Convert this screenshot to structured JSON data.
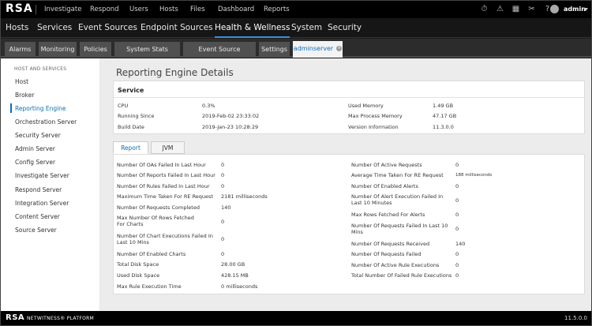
{
  "topbar": {
    "logo": "RSA",
    "nav": [
      "Investigate",
      "Respond",
      "Users",
      "Hosts",
      "Files",
      "Dashboard",
      "Reports"
    ],
    "user": "admin"
  },
  "secnav": {
    "items": [
      "Hosts",
      "Services",
      "Event Sources",
      "Endpoint Sources",
      "Health & Wellness",
      "System",
      "Security"
    ],
    "active": "Health & Wellness"
  },
  "subtabs": {
    "items": [
      "Alarms",
      "Monitoring",
      "Policies",
      "System Stats Browser",
      "Event Source Monitoring",
      "Settings",
      "adminserver"
    ],
    "active": "adminserver"
  },
  "sidebar": {
    "header": "HOST AND SERVICES",
    "items": [
      "Host",
      "Broker",
      "Reporting Engine",
      "Orchestration Server",
      "Security Server",
      "Admin Server",
      "Config Server",
      "Investigate Server",
      "Respond Server",
      "Integration Server",
      "Content Server",
      "Source Server"
    ],
    "active": "Reporting Engine"
  },
  "main": {
    "title": "Reporting Engine Details",
    "service": {
      "title": "Service",
      "left": [
        {
          "label": "CPU",
          "value": "0.3%"
        },
        {
          "label": "Running Since",
          "value": "2019-Feb-02 23:33:02"
        },
        {
          "label": "Build Date",
          "value": "2019-Jan-23 10:28:29"
        }
      ],
      "right": [
        {
          "label": "Used Memory",
          "value": "1.49 GB"
        },
        {
          "label": "Max Process Memory",
          "value": "47.17 GB"
        },
        {
          "label": "Version Information",
          "value": "11.3.0.0"
        }
      ]
    },
    "tabs": [
      "Report",
      "JVM"
    ],
    "active_tab": "Report",
    "report_left": [
      {
        "label": "Number Of OAs Failed In Last Hour",
        "value": "0"
      },
      {
        "label": "Number Of Reports Failed In Last Hour",
        "value": "0"
      },
      {
        "label": "Number Of Rules Failed In Last Hour",
        "value": "0"
      },
      {
        "label": "Maximum Time Taken For RE Request",
        "value": "2181 milliseconds"
      },
      {
        "label": "Number Of Requests Completed",
        "value": "140"
      },
      {
        "label": "Max Number Of Rows Fetched For Charts",
        "value": "0"
      },
      {
        "label": "Number Of Chart Executions Failed In Last 10 Mins",
        "value": "0"
      },
      {
        "label": "Number Of Enabled Charts",
        "value": "0"
      },
      {
        "label": "Total Disk Space",
        "value": "28.00 GB"
      },
      {
        "label": "Used Disk Space",
        "value": "428.15 MB"
      },
      {
        "label": "Max Rule Execution Time",
        "value": "0 milliseconds"
      }
    ],
    "report_right": [
      {
        "label": "Number Of Active Requests",
        "value": "0"
      },
      {
        "label": "Average Time Taken For RE Request",
        "value": "188 milliseconds"
      },
      {
        "label": "Number Of Enabled Alerts",
        "value": "0"
      },
      {
        "label": "Number Of Alert Execution Failed In Last 10 Minutes",
        "value": "0"
      },
      {
        "label": "Max Rows Fetched For Alerts",
        "value": "0"
      },
      {
        "label": "Number Of Requests Failed In Last 10 Mins",
        "value": "0"
      },
      {
        "label": "Number Of Requests Received",
        "value": "140"
      },
      {
        "label": "Number Of Requests Failed",
        "value": "0"
      },
      {
        "label": "Number Of Active Rule Executions",
        "value": "0"
      },
      {
        "label": "Total Number Of Failed Rule Executions",
        "value": "0"
      }
    ]
  },
  "footer": {
    "logo": "RSA",
    "platform": "NETWITNESS® PLATFORM",
    "version": "11.5.0.0"
  }
}
